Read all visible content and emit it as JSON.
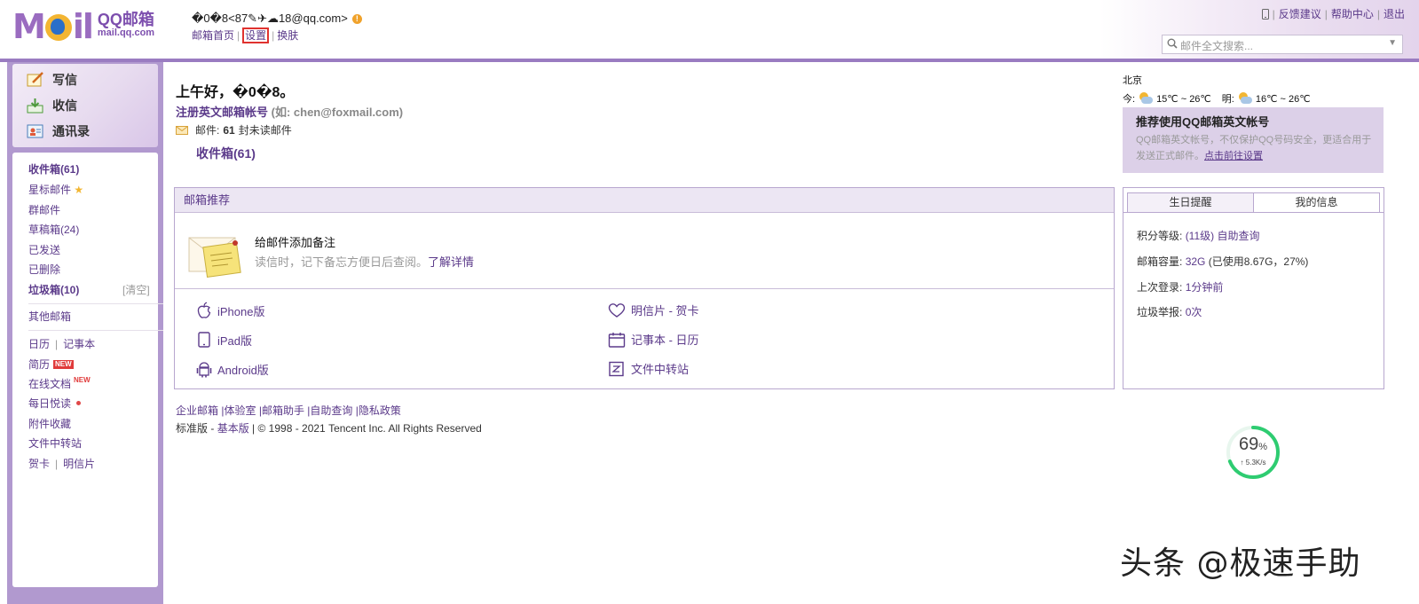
{
  "header": {
    "logo_text": "QQ邮箱",
    "logo_domain": "mail.qq.com",
    "user_display": "�0�8<87✎✈☁18@qq.com>",
    "nav": [
      "邮箱首页",
      "设置",
      "换肤"
    ],
    "right_links": [
      "反馈建议",
      "帮助中心",
      "退出"
    ],
    "search_placeholder": "邮件全文搜索..."
  },
  "toolbar": {
    "compose": "写信",
    "receive": "收信",
    "contacts": "通讯录"
  },
  "folders": {
    "inbox": "收件箱(61)",
    "starred": "星标邮件",
    "group": "群邮件",
    "drafts": "草稿箱(24)",
    "sent": "已发送",
    "deleted": "已删除",
    "spam": "垃圾箱(10)",
    "spam_clear": "[清空]",
    "other": "其他邮箱",
    "calendar": "日历",
    "notebook": "记事本",
    "resume": "简历",
    "resume_badge": "NEW",
    "docs": "在线文档",
    "docs_badge": "NEW",
    "daily": "每日悦读",
    "attachments": "附件收藏",
    "transfer": "文件中转站",
    "card": "贺卡",
    "postcard": "明信片"
  },
  "main": {
    "greeting": "上午好，�0�8。",
    "register_link": "注册英文邮箱帐号",
    "register_example": "(如: chen@foxmail.com)",
    "mail_label": "邮件:",
    "unread_count": "61",
    "unread_suffix": "封未读邮件",
    "inbox_link": "收件箱(61)"
  },
  "recommend": {
    "title": "邮箱推荐",
    "feature_title": "给邮件添加备注",
    "feature_desc": "读信时，记下备忘方便日后查阅。",
    "feature_link": "了解详情",
    "apps_left": [
      "iPhone版",
      "iPad版",
      "Android版"
    ],
    "apps_right": [
      "明信片 - 贺卡",
      "记事本 - 日历",
      "文件中转站"
    ]
  },
  "footer": {
    "links": [
      "企业邮箱",
      "体验室",
      "邮箱助手",
      "自助查询",
      "隐私政策"
    ],
    "version_standard": "标准版",
    "version_basic": "基本版",
    "copyright": "© 1998 - 2021 Tencent Inc. All Rights Reserved"
  },
  "weather": {
    "city": "北京",
    "today_label": "今:",
    "today_temp": "15℃ ~ 26℃",
    "tomorrow_label": "明:",
    "tomorrow_temp": "16℃ ~ 26℃"
  },
  "promo": {
    "title": "推荐使用QQ邮箱英文帐号",
    "desc": "QQ邮箱英文帐号，不仅保护QQ号码安全，更适合用于发送正式邮件。",
    "link": "点击前往设置"
  },
  "info": {
    "tabs": [
      "生日提醒",
      "我的信息"
    ],
    "rows": [
      {
        "label": "积分等级:",
        "value": "(11级)",
        "extra": "自助查询"
      },
      {
        "label": "邮箱容量:",
        "value": "32G",
        "extra": "(已使用8.67G，27%)"
      },
      {
        "label": "上次登录:",
        "value": "1分钟前",
        "extra": ""
      },
      {
        "label": "垃圾举报:",
        "value": "0次",
        "extra": ""
      }
    ]
  },
  "gauge": {
    "percent": "69",
    "percent_sign": "%",
    "speed": "↑ 5.3K/s",
    "fraction": 0.69
  },
  "watermark": "头条 @极速手助",
  "colors": {
    "accent": "#5b3a8a",
    "band": "#9a7cc1",
    "highlight": "#e0322f",
    "gauge": "#2ecc71"
  }
}
